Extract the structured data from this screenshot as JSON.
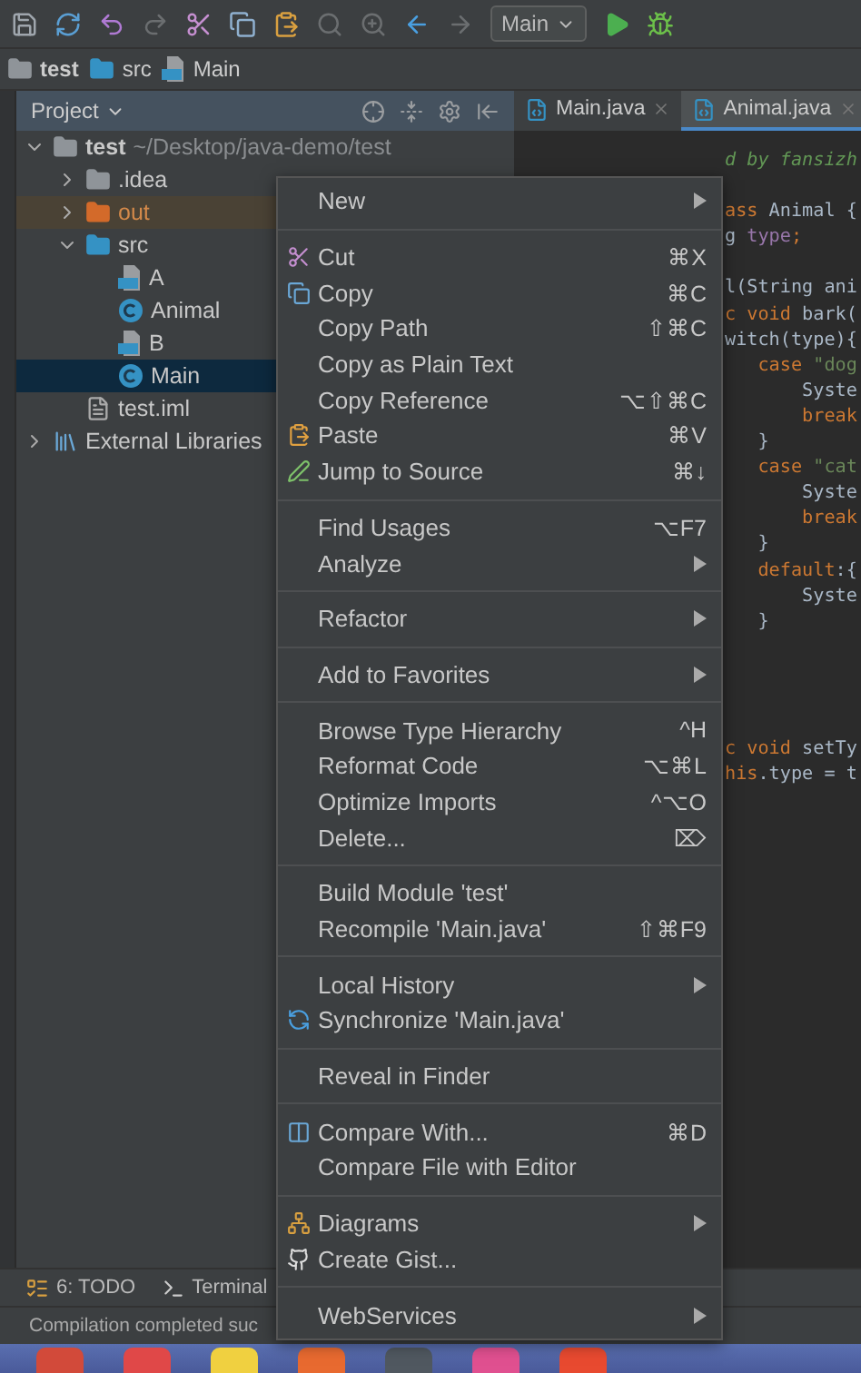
{
  "toolbar": {
    "run_config": "Main"
  },
  "breadcrumbs": [
    {
      "label": "test",
      "kind": "module"
    },
    {
      "label": "src",
      "kind": "source-folder"
    },
    {
      "label": "Main",
      "kind": "java-file"
    }
  ],
  "project_panel": {
    "title": "Project",
    "tree": [
      {
        "label": "test",
        "path": "~/Desktop/java-demo/test",
        "kind": "module",
        "expanded": true,
        "selected": false,
        "children": [
          {
            "label": ".idea",
            "kind": "folder",
            "expanded": false,
            "selected": false
          },
          {
            "label": "out",
            "kind": "excluded-folder",
            "expanded": false,
            "selected": false
          },
          {
            "label": "src",
            "kind": "source-folder",
            "expanded": true,
            "selected": false,
            "children": [
              {
                "label": "A",
                "kind": "java-file",
                "selected": false
              },
              {
                "label": "Animal",
                "kind": "class",
                "selected": false
              },
              {
                "label": "B",
                "kind": "java-file",
                "selected": false
              },
              {
                "label": "Main",
                "kind": "class",
                "selected": true
              }
            ]
          },
          {
            "label": "test.iml",
            "kind": "module-file",
            "selected": false
          }
        ]
      },
      {
        "label": "External Libraries",
        "kind": "libraries",
        "expanded": false,
        "selected": false
      }
    ]
  },
  "editor": {
    "tabs": [
      {
        "label": "Main.java",
        "selected": false
      },
      {
        "label": "Animal.java",
        "selected": true
      }
    ],
    "lines": [
      {
        "kind": "code",
        "segments": [
          {
            "text": "d by fansizh",
            "kind": "comment"
          }
        ]
      },
      {
        "kind": "blank"
      },
      {
        "kind": "code",
        "segments": [
          {
            "text": "ass",
            "kind": "keyword"
          },
          {
            "text": " Animal {",
            "kind": "plain"
          }
        ]
      },
      {
        "kind": "code",
        "segments": [
          {
            "text": "g ",
            "kind": "plain"
          },
          {
            "text": "type",
            "kind": "field"
          },
          {
            "text": ";",
            "kind": "keyword"
          }
        ]
      },
      {
        "kind": "blank"
      },
      {
        "kind": "code",
        "segments": [
          {
            "text": "l(String ani",
            "kind": "plain"
          }
        ]
      },
      {
        "kind": "code",
        "segments": [
          {
            "text": "c void",
            "kind": "keyword"
          },
          {
            "text": " bark(",
            "kind": "plain"
          }
        ]
      },
      {
        "kind": "code",
        "segments": [
          {
            "text": "witch(type){",
            "kind": "plain"
          }
        ]
      },
      {
        "kind": "code",
        "segments": [
          {
            "text": "   case ",
            "kind": "keyword"
          },
          {
            "text": "\"dog",
            "kind": "string"
          }
        ]
      },
      {
        "kind": "code",
        "segments": [
          {
            "text": "       Syste",
            "kind": "plain"
          }
        ]
      },
      {
        "kind": "code",
        "segments": [
          {
            "text": "       break",
            "kind": "keyword"
          }
        ]
      },
      {
        "kind": "code",
        "segments": [
          {
            "text": "   }",
            "kind": "plain"
          }
        ]
      },
      {
        "kind": "code",
        "segments": [
          {
            "text": "   case ",
            "kind": "keyword"
          },
          {
            "text": "\"cat",
            "kind": "string"
          }
        ]
      },
      {
        "kind": "code",
        "segments": [
          {
            "text": "       Syste",
            "kind": "plain"
          }
        ]
      },
      {
        "kind": "code",
        "segments": [
          {
            "text": "       break",
            "kind": "keyword"
          }
        ]
      },
      {
        "kind": "code",
        "segments": [
          {
            "text": "   }",
            "kind": "plain"
          }
        ]
      },
      {
        "kind": "code",
        "segments": [
          {
            "text": "   default",
            "kind": "keyword"
          },
          {
            "text": ":{",
            "kind": "plain"
          }
        ]
      },
      {
        "kind": "code",
        "segments": [
          {
            "text": "       Syste",
            "kind": "plain"
          }
        ]
      },
      {
        "kind": "code",
        "segments": [
          {
            "text": "   }",
            "kind": "plain"
          }
        ]
      },
      {
        "kind": "blank"
      },
      {
        "kind": "blank"
      },
      {
        "kind": "blank"
      },
      {
        "kind": "blank"
      },
      {
        "kind": "code",
        "segments": [
          {
            "text": "c void",
            "kind": "keyword"
          },
          {
            "text": " setTy",
            "kind": "plain"
          }
        ]
      },
      {
        "kind": "code",
        "segments": [
          {
            "text": "his",
            "kind": "keyword"
          },
          {
            "text": ".type = t",
            "kind": "plain"
          }
        ]
      }
    ]
  },
  "context_menu": {
    "groups": [
      [
        {
          "label": "New",
          "submenu": true,
          "kind": "plain"
        }
      ],
      [
        {
          "label": "Cut",
          "shortcut": "⌘X",
          "kind": "cut"
        },
        {
          "label": "Copy",
          "shortcut": "⌘C",
          "kind": "copy"
        },
        {
          "label": "Copy Path",
          "shortcut": "⇧⌘C",
          "kind": "plain"
        },
        {
          "label": "Copy as Plain Text",
          "kind": "plain"
        },
        {
          "label": "Copy Reference",
          "shortcut": "⌥⇧⌘C",
          "kind": "plain"
        },
        {
          "label": "Paste",
          "shortcut": "⌘V",
          "kind": "paste"
        },
        {
          "label": "Jump to Source",
          "shortcut": "⌘↓",
          "kind": "jump"
        }
      ],
      [
        {
          "label": "Find Usages",
          "shortcut": "⌥F7",
          "kind": "plain"
        },
        {
          "label": "Analyze",
          "submenu": true,
          "kind": "plain"
        }
      ],
      [
        {
          "label": "Refactor",
          "submenu": true,
          "kind": "plain"
        }
      ],
      [
        {
          "label": "Add to Favorites",
          "submenu": true,
          "kind": "plain"
        }
      ],
      [
        {
          "label": "Browse Type Hierarchy",
          "shortcut": "^H",
          "kind": "plain"
        },
        {
          "label": "Reformat Code",
          "shortcut": "⌥⌘L",
          "kind": "plain"
        },
        {
          "label": "Optimize Imports",
          "shortcut": "^⌥O",
          "kind": "plain"
        },
        {
          "label": "Delete...",
          "shortcut": "⌦",
          "kind": "plain"
        }
      ],
      [
        {
          "label": "Build Module 'test'",
          "kind": "plain"
        },
        {
          "label": "Recompile 'Main.java'",
          "shortcut": "⇧⌘F9",
          "kind": "plain"
        }
      ],
      [
        {
          "label": "Local History",
          "submenu": true,
          "kind": "plain"
        },
        {
          "label": "Synchronize 'Main.java'",
          "kind": "sync"
        }
      ],
      [
        {
          "label": "Reveal in Finder",
          "kind": "plain"
        }
      ],
      [
        {
          "label": "Compare With...",
          "shortcut": "⌘D",
          "kind": "compare"
        },
        {
          "label": "Compare File with Editor",
          "kind": "plain"
        }
      ],
      [
        {
          "label": "Diagrams",
          "submenu": true,
          "kind": "diagrams"
        },
        {
          "label": "Create Gist...",
          "kind": "gist"
        }
      ],
      [
        {
          "label": "WebServices",
          "submenu": true,
          "kind": "plain"
        }
      ]
    ]
  },
  "tool_tabs": [
    {
      "label": "6: TODO",
      "kind": "todo"
    },
    {
      "label": "Terminal",
      "kind": "terminal"
    }
  ],
  "status_bar": {
    "message": "Compilation completed suc"
  }
}
